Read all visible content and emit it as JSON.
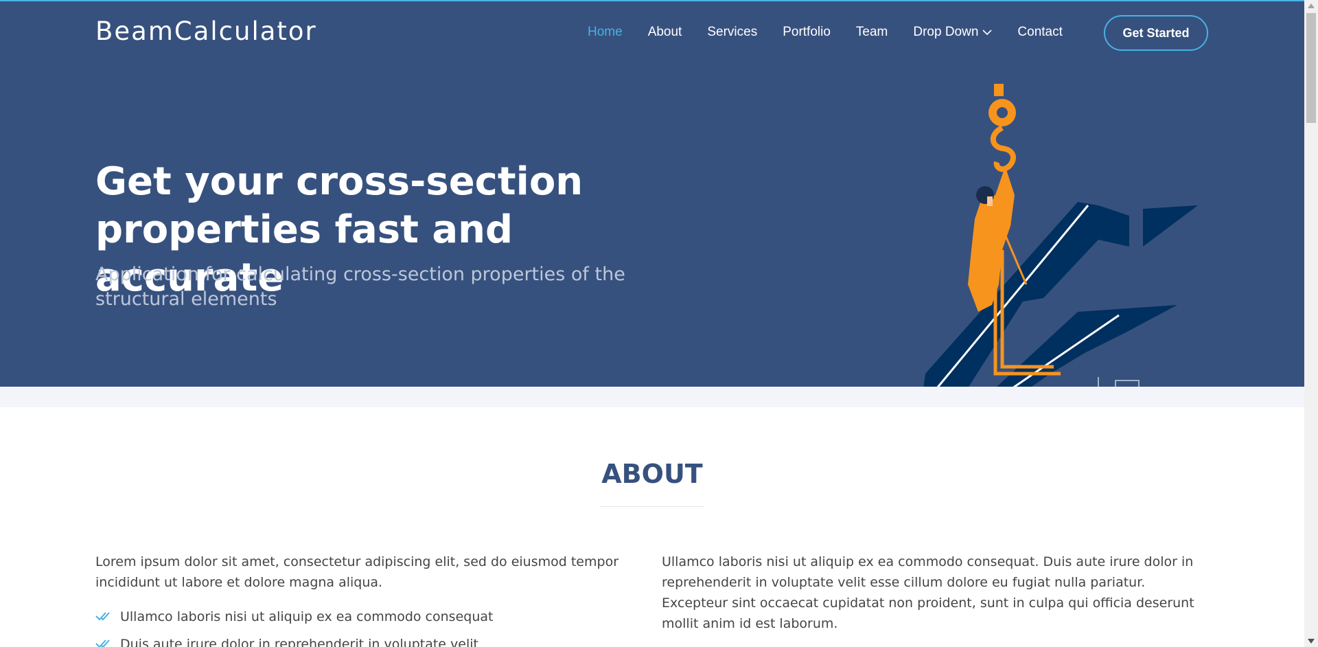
{
  "header": {
    "logo": "BeamCalculator",
    "nav": [
      {
        "label": "Home",
        "active": true
      },
      {
        "label": "About"
      },
      {
        "label": "Services"
      },
      {
        "label": "Portfolio"
      },
      {
        "label": "Team"
      },
      {
        "label": "Drop Down",
        "dropdown": true
      },
      {
        "label": "Contact"
      }
    ],
    "cta_label": "Get Started"
  },
  "hero": {
    "title": "Get your cross-section properties fast and accurate",
    "subtitle": "Application for calculating cross-section properties of the structural elements"
  },
  "about": {
    "title": "ABOUT",
    "left_text": "Lorem ipsum dolor sit amet, consectetur adipiscing elit, sed do eiusmod tempor incididunt ut labore et dolore magna aliqua.",
    "list": [
      "Ullamco laboris nisi ut aliquip ex ea commodo consequat",
      "Duis aute irure dolor in reprehenderit in voluptate velit"
    ],
    "right_text": "Ullamco laboris nisi ut aliquip ex ea commodo consequat. Duis aute irure dolor in reprehenderit in voluptate velit esse cillum dolore eu fugiat nulla pariatur. Excepteur sint occaecat cupidatat non proident, sunt in culpa qui officia deserunt mollit anim id est laborum."
  },
  "colors": {
    "hero_bg": "#37517e",
    "accent": "#47b2e4",
    "worker": "#f7941d",
    "beam": "#00305f"
  },
  "icons": {
    "dropdown": "chevron-down-icon",
    "list_bullet": "double-check-icon"
  }
}
